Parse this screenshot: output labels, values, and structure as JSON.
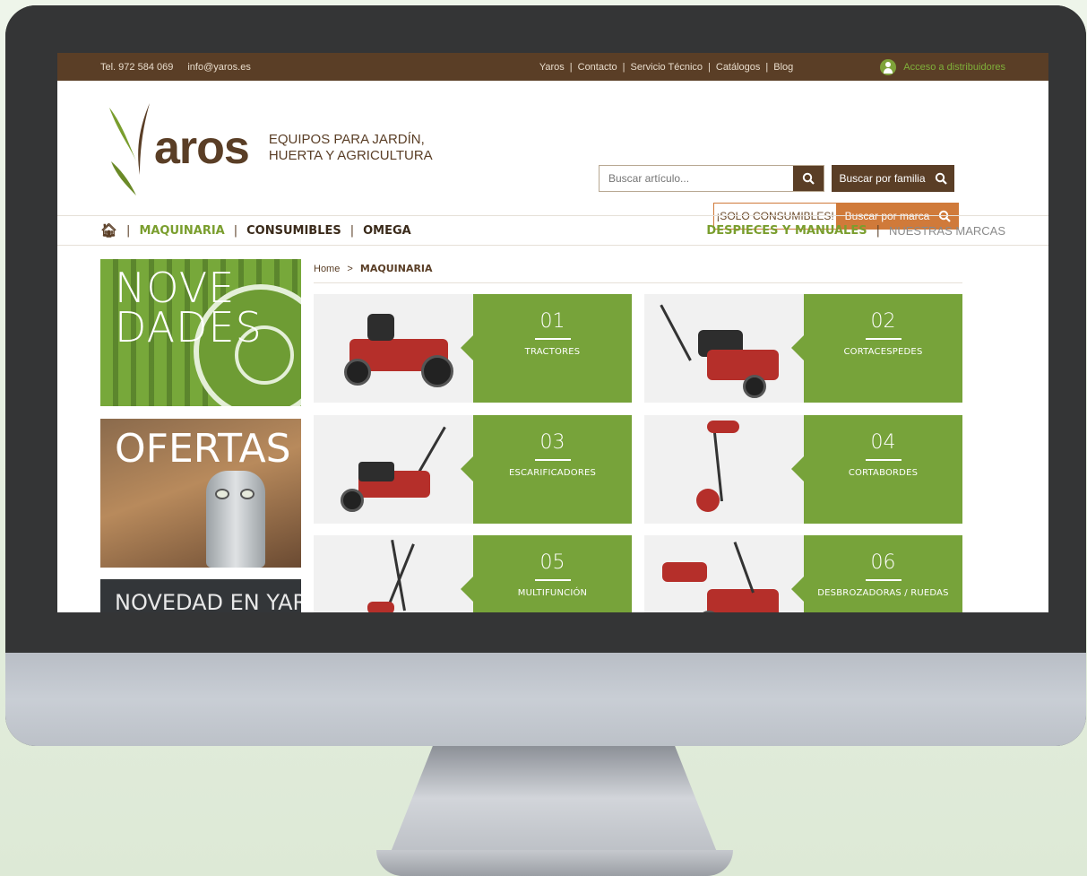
{
  "topbar": {
    "phone": "Tel. 972 584 069",
    "email": "info@yaros.es",
    "links": [
      "Yaros",
      "|",
      "Contacto",
      "|",
      "Servicio Técnico",
      "|",
      "Catálogos",
      "|",
      "Blog"
    ],
    "distributors": "Acceso a distribuidores"
  },
  "header": {
    "logo_text": "aros",
    "tagline_1": "EQUIPOS PARA JARDÍN,",
    "tagline_2": "HUERTA Y AGRICULTURA",
    "search_placeholder": "Buscar artículo...",
    "family_button": "Buscar por familia",
    "consumibles_button": "¡SOLO CONSUMIBLES!",
    "brand_button": "Buscar por marca"
  },
  "nav": {
    "items": [
      "MAQUINARIA",
      "CONSUMIBLES",
      "OMEGA"
    ],
    "right_items": [
      "DESPIECES Y MANUALES",
      "NUESTRAS MARCAS"
    ]
  },
  "sidebar": {
    "novedades_1": "NOVE",
    "novedades_2": "DADES",
    "ofertas": "OFERTAS",
    "novedad_yaros": "NOVEDAD EN YAROS"
  },
  "breadcrumb": {
    "home": "Home",
    "sep": ">",
    "current": "MAQUINARIA"
  },
  "categories": [
    {
      "num": "01",
      "label": "TRACTORES"
    },
    {
      "num": "02",
      "label": "CORTACESPEDES"
    },
    {
      "num": "03",
      "label": "ESCARIFICADORES"
    },
    {
      "num": "04",
      "label": "CORTABORDES"
    },
    {
      "num": "05",
      "label": "MULTIFUNCIÓN"
    },
    {
      "num": "06",
      "label": "DESBROZADORAS / RUEDAS"
    }
  ],
  "colors": {
    "brown": "#5a3e26",
    "green": "#77a33a",
    "orange": "#d07a3a"
  }
}
